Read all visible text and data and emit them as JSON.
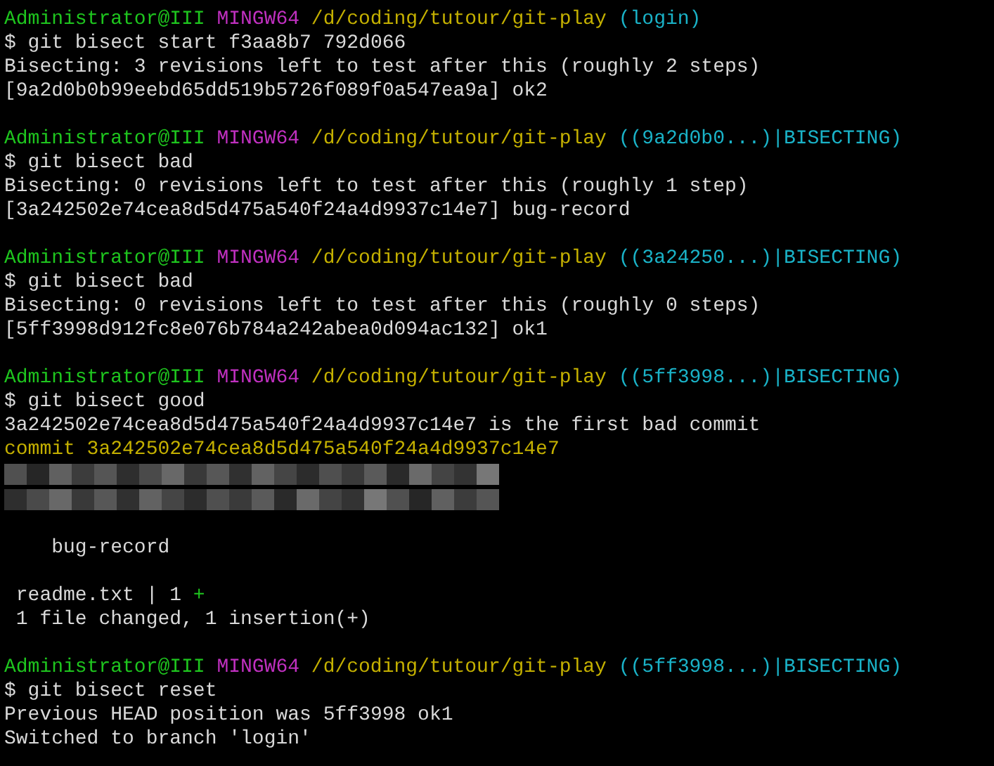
{
  "terminal": {
    "lines": [
      {
        "kind": "prompt",
        "user": "Administrator@III",
        "shell": "MINGW64",
        "path": "/d/coding/tutour/git-play",
        "branch": "(login)"
      },
      {
        "kind": "command",
        "text": "$ git bisect start f3aa8b7 792d066"
      },
      {
        "kind": "output",
        "text": "Bisecting: 3 revisions left to test after this (roughly 2 steps)"
      },
      {
        "kind": "output",
        "text": "[9a2d0b0b99eebd65dd519b5726f089f0a547ea9a] ok2"
      },
      {
        "kind": "blank"
      },
      {
        "kind": "prompt",
        "user": "Administrator@III",
        "shell": "MINGW64",
        "path": "/d/coding/tutour/git-play",
        "branch": "((9a2d0b0...)|BISECTING)"
      },
      {
        "kind": "command",
        "text": "$ git bisect bad"
      },
      {
        "kind": "output",
        "text": "Bisecting: 0 revisions left to test after this (roughly 1 step)"
      },
      {
        "kind": "output",
        "text": "[3a242502e74cea8d5d475a540f24a4d9937c14e7] bug-record"
      },
      {
        "kind": "blank"
      },
      {
        "kind": "prompt",
        "user": "Administrator@III",
        "shell": "MINGW64",
        "path": "/d/coding/tutour/git-play",
        "branch": "((3a24250...)|BISECTING)"
      },
      {
        "kind": "command",
        "text": "$ git bisect bad"
      },
      {
        "kind": "output",
        "text": "Bisecting: 0 revisions left to test after this (roughly 0 steps)"
      },
      {
        "kind": "output",
        "text": "[5ff3998d912fc8e076b784a242abea0d094ac132] ok1"
      },
      {
        "kind": "blank"
      },
      {
        "kind": "prompt",
        "user": "Administrator@III",
        "shell": "MINGW64",
        "path": "/d/coding/tutour/git-play",
        "branch": "((5ff3998...)|BISECTING)"
      },
      {
        "kind": "command",
        "text": "$ git bisect good"
      },
      {
        "kind": "output",
        "text": "3a242502e74cea8d5d475a540f24a4d9937c14e7 is the first bad commit"
      },
      {
        "kind": "commit",
        "text": "commit 3a242502e74cea8d5d475a540f24a4d9937c14e7"
      },
      {
        "kind": "redacted"
      },
      {
        "kind": "redacted"
      },
      {
        "kind": "blank"
      },
      {
        "kind": "output",
        "text": "    bug-record"
      },
      {
        "kind": "blank"
      },
      {
        "kind": "stat",
        "text": " readme.txt | 1 ",
        "plus": "+"
      },
      {
        "kind": "output",
        "text": " 1 file changed, 1 insertion(+)"
      },
      {
        "kind": "blank"
      },
      {
        "kind": "prompt",
        "user": "Administrator@III",
        "shell": "MINGW64",
        "path": "/d/coding/tutour/git-play",
        "branch": "((5ff3998...)|BISECTING)"
      },
      {
        "kind": "command",
        "text": "$ git bisect reset"
      },
      {
        "kind": "output",
        "text": "Previous HEAD position was 5ff3998 ok1"
      },
      {
        "kind": "output",
        "text": "Switched to branch 'login'"
      }
    ]
  }
}
